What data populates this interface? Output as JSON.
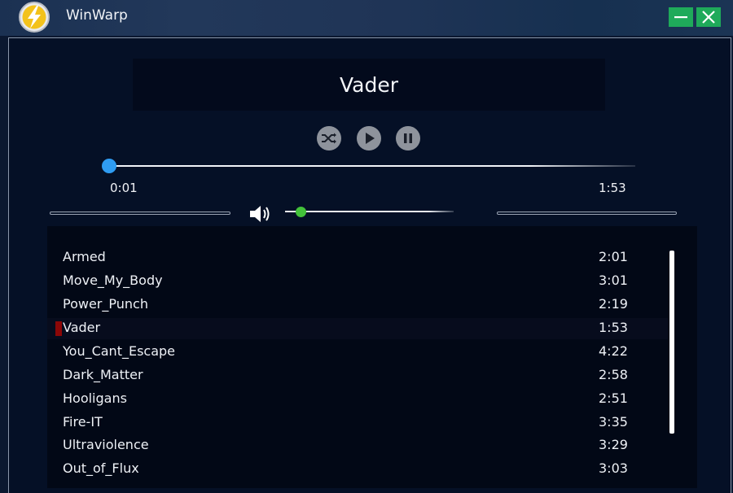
{
  "window": {
    "title": "WinWarp",
    "logo_icon": "lightning-bolt-icon",
    "minimize_icon": "minimize-icon",
    "close_icon": "close-icon",
    "accent_color": "#1faa5a"
  },
  "player": {
    "now_playing": "Vader",
    "controls": [
      "shuffle-icon",
      "play-icon",
      "pause-icon"
    ],
    "elapsed": "0:01",
    "total": "1:53",
    "progress_fraction": 0.01,
    "volume_fraction": 0.08,
    "seek_color": "#2f9cf2",
    "volume_color": "#43c23a"
  },
  "playlist": {
    "tracks": [
      {
        "name": "Armed",
        "duration": "2:01"
      },
      {
        "name": "Move_My_Body",
        "duration": "3:01"
      },
      {
        "name": "Power_Punch",
        "duration": "2:19"
      },
      {
        "name": "Vader",
        "duration": "1:53"
      },
      {
        "name": "You_Cant_Escape",
        "duration": "4:22"
      },
      {
        "name": "Dark_Matter",
        "duration": "2:58"
      },
      {
        "name": "Hooligans",
        "duration": "2:51"
      },
      {
        "name": "Fire-IT",
        "duration": "3:35"
      },
      {
        "name": "Ultraviolence",
        "duration": "3:29"
      },
      {
        "name": "Out_of_Flux",
        "duration": "3:03"
      }
    ],
    "current_index": 3,
    "current_marker_color": "#8c0707"
  }
}
